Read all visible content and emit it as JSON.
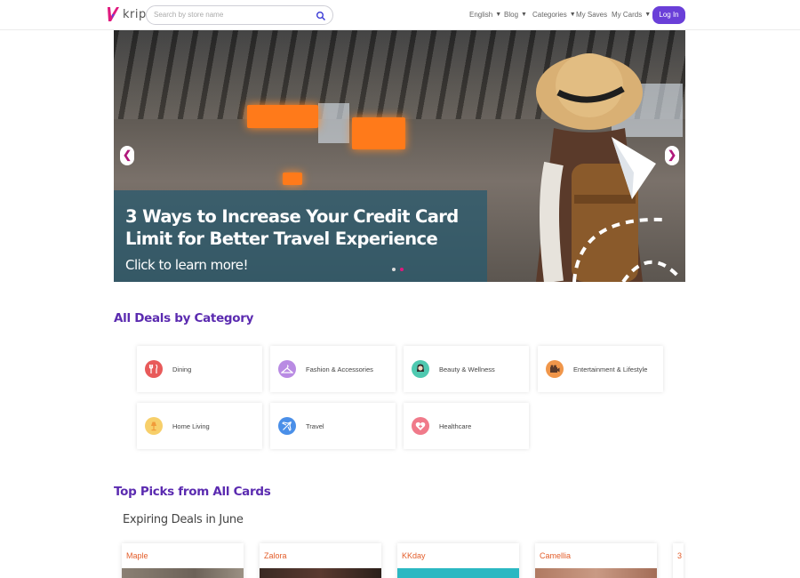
{
  "header": {
    "logo_text": "krip",
    "search_placeholder": "Search by store name",
    "nav": [
      {
        "label": "English",
        "has_dropdown": true
      },
      {
        "label": "Blog",
        "has_dropdown": true
      },
      {
        "label": "Categories",
        "has_dropdown": true
      },
      {
        "label": "My Saves",
        "has_dropdown": false
      },
      {
        "label": "My Cards",
        "has_dropdown": true
      }
    ],
    "login_label": "Log In",
    "brand_color": "#6a3fd8"
  },
  "banner": {
    "title": "3 Ways to Increase Your Credit Card Limit for Better Travel Experience",
    "cta": "Click to learn more!",
    "slides_total": 2,
    "active_slide": 2
  },
  "categories_section": {
    "title": "All Deals by Category",
    "items": [
      {
        "label": "Dining",
        "icon": "utensils-icon",
        "color": "#e85a5a"
      },
      {
        "label": "Fashion & Accessories",
        "icon": "hanger-icon",
        "color": "#b98be3"
      },
      {
        "label": "Beauty & Wellness",
        "icon": "woman-icon",
        "color": "#4fc9b0"
      },
      {
        "label": "Entertainment & Lifestyle",
        "icon": "camera-icon",
        "color": "#f0964a"
      },
      {
        "label": "Home Living",
        "icon": "lamp-icon",
        "color": "#f7cf6a"
      },
      {
        "label": "Travel",
        "icon": "plane-icon",
        "color": "#4a8fe8"
      },
      {
        "label": "Healthcare",
        "icon": "heart-icon",
        "color": "#f07a8a"
      }
    ]
  },
  "top_picks": {
    "title": "Top Picks from All Cards",
    "subtitle": "Expiring Deals in June",
    "deals": [
      {
        "name": "Maple"
      },
      {
        "name": "Zalora"
      },
      {
        "name": "KKday"
      },
      {
        "name": "Camellia"
      },
      {
        "name": "3"
      }
    ]
  }
}
